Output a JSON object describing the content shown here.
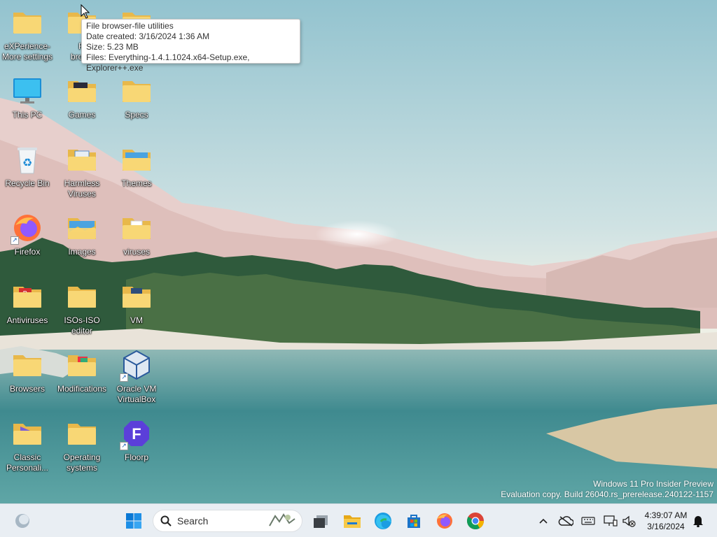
{
  "desktop": {
    "icons": [
      {
        "label": "eXPerience-More settings",
        "icon": "folder-icon"
      },
      {
        "label": "File browser-file utilities",
        "icon": "folder-icon"
      },
      {
        "label": "",
        "icon": "folder-icon"
      },
      {
        "label": "This PC",
        "icon": "monitor-icon"
      },
      {
        "label": "Games",
        "icon": "folder-icon"
      },
      {
        "label": "Specs",
        "icon": "folder-icon"
      },
      {
        "label": "Recycle Bin",
        "icon": "recycle-bin-icon"
      },
      {
        "label": "Harmless Viruses",
        "icon": "folder-icon"
      },
      {
        "label": "Themes",
        "icon": "folder-icon"
      },
      {
        "label": "Firefox",
        "icon": "firefox-icon"
      },
      {
        "label": "Images",
        "icon": "folder-icon"
      },
      {
        "label": "viruses",
        "icon": "folder-icon"
      },
      {
        "label": "Antiviruses",
        "icon": "folder-icon"
      },
      {
        "label": "ISOs-ISO editor",
        "icon": "folder-icon"
      },
      {
        "label": "VM",
        "icon": "folder-icon"
      },
      {
        "label": "Browsers",
        "icon": "folder-icon"
      },
      {
        "label": "Modifications",
        "icon": "folder-icon"
      },
      {
        "label": "Oracle VM VirtualBox",
        "icon": "virtualbox-icon"
      },
      {
        "label": "Classic Personali...",
        "icon": "folder-icon"
      },
      {
        "label": "Operating systems",
        "icon": "folder-icon"
      },
      {
        "label": "Floorp",
        "icon": "floorp-icon"
      }
    ],
    "partial_labels": {
      "file_browser_line1": "Fi",
      "file_browser_line2": "brows"
    }
  },
  "tooltip": {
    "title": "File browser-file utilities",
    "date_created": "Date created: 3/16/2024 1:36 AM",
    "size": "Size: 5.23 MB",
    "files": "Files: Everything-1.4.1.1024.x64-Setup.exe, Explorer++.exe"
  },
  "watermark": {
    "line1": "Windows 11 Pro Insider Preview",
    "line2": "Evaluation copy. Build 26040.rs_prerelease.240122-1157"
  },
  "taskbar": {
    "widgets_icon": "widgets-icon",
    "start_icon": "windows-start-icon",
    "search_placeholder": "Search",
    "pinned": [
      "task-view-icon",
      "file-explorer-icon",
      "edge-icon",
      "store-icon",
      "firefox-icon",
      "chrome-icon"
    ],
    "tray": [
      "chevron-up-icon",
      "onedrive-icon",
      "keyboard-icon",
      "network-icon",
      "volume-muted-icon"
    ],
    "clock_time": "4:39:07 AM",
    "clock_date": "3/16/2024",
    "notifications_icon": "bell-icon"
  },
  "colors": {
    "folder": "#f8d775",
    "folder_dark": "#e8b84a",
    "accent": "#0078d4",
    "taskbar": "#e9eef3"
  }
}
